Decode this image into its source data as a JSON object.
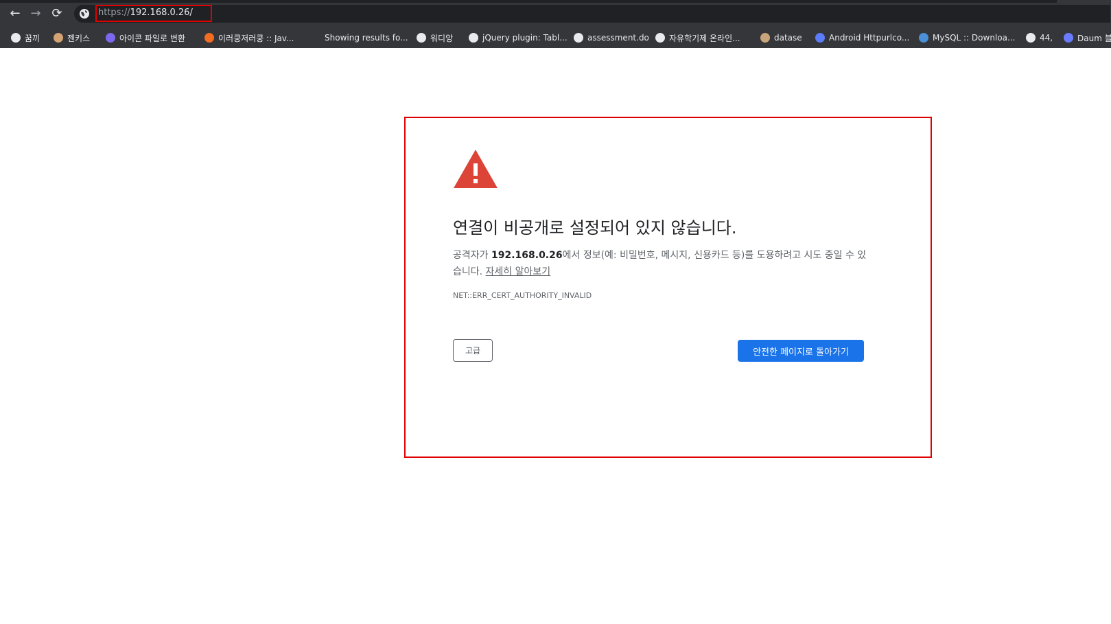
{
  "toolbar": {
    "back_icon": "←",
    "forward_icon": "→",
    "reload_icon": "⟳",
    "url_scheme": "https://",
    "url_host": "192.168.0.26/"
  },
  "bookmarks": [
    {
      "label": "꿈끼",
      "icon": "globe-icon",
      "color": "#e8eaed"
    },
    {
      "label": "젠키스",
      "icon": "jenkins-icon",
      "color": "#d4a373"
    },
    {
      "label": "아이콘 파일로 변환",
      "icon": "convert-icon",
      "color": "#7b68ee"
    },
    {
      "label": "이러쿵저러쿵 :: Jav...",
      "icon": "blog-icon",
      "color": "#f26d21"
    },
    {
      "label": "Showing results fo...",
      "icon": "nu-icon",
      "color": "#35363a"
    },
    {
      "label": "워디앙",
      "icon": "globe-icon",
      "color": "#e8eaed"
    },
    {
      "label": "jQuery plugin: Tabl...",
      "icon": "globe-icon",
      "color": "#e8eaed"
    },
    {
      "label": "assessment.do",
      "icon": "globe-icon",
      "color": "#e8eaed"
    },
    {
      "label": "자유학기제 온라인...",
      "icon": "globe-icon",
      "color": "#e8eaed"
    },
    {
      "label": "datase",
      "icon": "dataset-icon",
      "color": "#c8a57a"
    },
    {
      "label": "Android Httpurlco...",
      "icon": "code-icon",
      "color": "#5c7cfa"
    },
    {
      "label": "MySQL :: Downloa...",
      "icon": "mysql-icon",
      "color": "#4a90d9"
    },
    {
      "label": "44,",
      "icon": "globe-icon",
      "color": "#e8eaed"
    },
    {
      "label": "Daum 블",
      "icon": "daum-icon",
      "color": "#6a7bff"
    }
  ],
  "interstitial": {
    "title": "연결이 비공개로 설정되어 있지 않습니다.",
    "desc_prefix": "공격자가 ",
    "desc_host": "192.168.0.26",
    "desc_suffix": "에서 정보(예: 비밀번호, 메시지, 신용카드 등)를 도용하려고 시도 중일 수 있습니다. ",
    "learn_more": "자세히 알아보기",
    "error_code": "NET::ERR_CERT_AUTHORITY_INVALID",
    "advanced_label": "고급",
    "back_label": "안전한 페이지로 돌아가기"
  },
  "colors": {
    "warning": "#db4437",
    "primary_button": "#1a73e8",
    "highlight": "#e00000"
  }
}
